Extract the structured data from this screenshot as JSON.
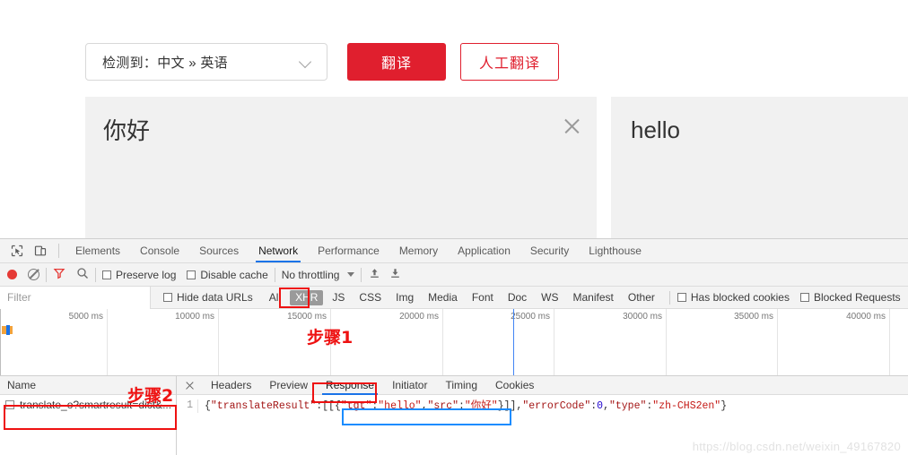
{
  "translate": {
    "lang_selector": "检测到：中文 » 英语",
    "translate_button": "翻译",
    "human_translate_button": "人工翻译",
    "source_text": "你好",
    "target_text": "hello"
  },
  "devtools": {
    "tabs": [
      {
        "label": "Elements",
        "active": false
      },
      {
        "label": "Console",
        "active": false
      },
      {
        "label": "Sources",
        "active": false
      },
      {
        "label": "Network",
        "active": true
      },
      {
        "label": "Performance",
        "active": false
      },
      {
        "label": "Memory",
        "active": false
      },
      {
        "label": "Application",
        "active": false
      },
      {
        "label": "Security",
        "active": false
      },
      {
        "label": "Lighthouse",
        "active": false
      }
    ],
    "toolbar": {
      "preserve_log": "Preserve log",
      "disable_cache": "Disable cache",
      "throttling": "No throttling"
    },
    "filters": {
      "filter_placeholder": "Filter",
      "hide_data_urls": "Hide data URLs",
      "types": [
        {
          "label": "All",
          "selected": false
        },
        {
          "label": "XHR",
          "selected": true
        },
        {
          "label": "JS",
          "selected": false
        },
        {
          "label": "CSS",
          "selected": false
        },
        {
          "label": "Img",
          "selected": false
        },
        {
          "label": "Media",
          "selected": false
        },
        {
          "label": "Font",
          "selected": false
        },
        {
          "label": "Doc",
          "selected": false
        },
        {
          "label": "WS",
          "selected": false
        },
        {
          "label": "Manifest",
          "selected": false
        },
        {
          "label": "Other",
          "selected": false
        }
      ],
      "has_blocked_cookies": "Has blocked cookies",
      "blocked_requests": "Blocked Requests"
    },
    "overview": {
      "ticks": [
        "5000 ms",
        "10000 ms",
        "15000 ms",
        "20000 ms",
        "25000 ms",
        "30000 ms",
        "35000 ms",
        "40000 ms"
      ]
    },
    "request_list": {
      "header": "Name",
      "rows": [
        {
          "name": "translate_o?smartresult=dict&..."
        }
      ]
    },
    "detail_tabs": [
      {
        "label": "Headers",
        "active": false
      },
      {
        "label": "Preview",
        "active": false
      },
      {
        "label": "Response",
        "active": true
      },
      {
        "label": "Initiator",
        "active": false
      },
      {
        "label": "Timing",
        "active": false
      },
      {
        "label": "Cookies",
        "active": false
      }
    ],
    "response": {
      "line_number": "1",
      "segments": [
        {
          "text": "{",
          "cls": "c-punc"
        },
        {
          "text": "\"translateResult\"",
          "cls": "c-key"
        },
        {
          "text": ":[[{",
          "cls": "c-punc"
        },
        {
          "text": "\"tgt\"",
          "cls": "c-key"
        },
        {
          "text": ":",
          "cls": "c-punc"
        },
        {
          "text": "\"hello\"",
          "cls": "c-str"
        },
        {
          "text": ",",
          "cls": "c-punc"
        },
        {
          "text": "\"src\"",
          "cls": "c-key"
        },
        {
          "text": ":",
          "cls": "c-punc"
        },
        {
          "text": "\"你好\"",
          "cls": "c-str"
        },
        {
          "text": "}]],",
          "cls": "c-punc"
        },
        {
          "text": "\"errorCode\"",
          "cls": "c-key"
        },
        {
          "text": ":",
          "cls": "c-punc"
        },
        {
          "text": "0",
          "cls": "c-num"
        },
        {
          "text": ",",
          "cls": "c-punc"
        },
        {
          "text": "\"type\"",
          "cls": "c-key"
        },
        {
          "text": ":",
          "cls": "c-punc"
        },
        {
          "text": "\"zh-CHS2en\"",
          "cls": "c-str"
        },
        {
          "text": "}",
          "cls": "c-punc"
        }
      ],
      "full_text": "{\"translateResult\":[[{\"tgt\":\"hello\",\"src\":\"你好\"}]],\"errorCode\":0,\"type\":\"zh-CHS2en\"}"
    }
  },
  "annotations": {
    "step1": "步骤1",
    "step2": "步骤2"
  },
  "watermark": "https://blog.csdn.net/weixin_49167820",
  "colors": {
    "accent_red": "#e01f2e",
    "annotation_red": "#ee1111",
    "annotation_blue": "#1a8cff",
    "devtools_blue": "#1a73e8"
  }
}
